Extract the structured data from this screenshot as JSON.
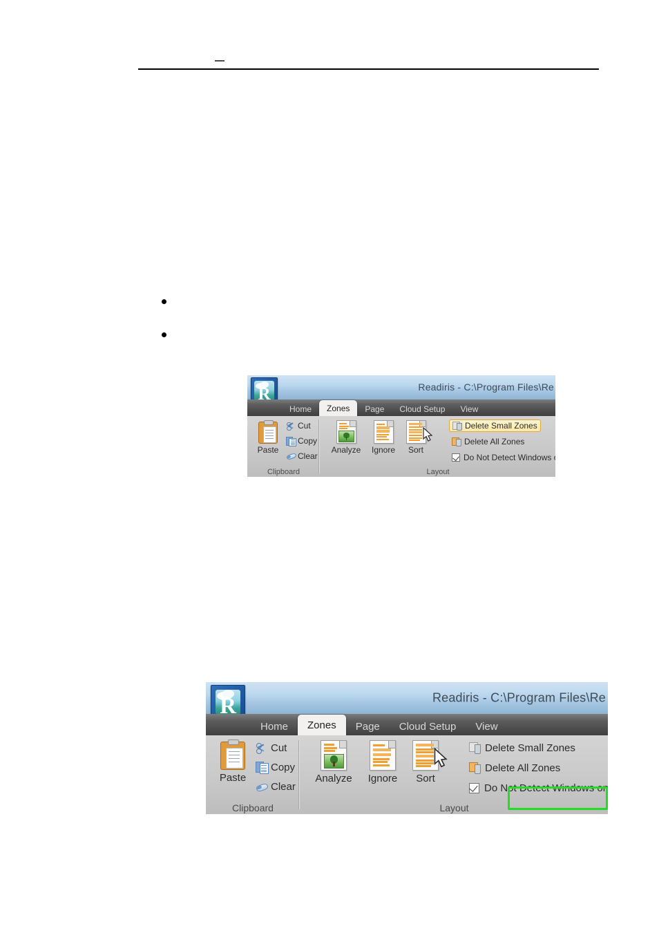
{
  "document": {
    "header_dash": "—",
    "bullets": [
      {
        "text": ""
      },
      {
        "text": ""
      }
    ]
  },
  "app": {
    "title": "Readiris - C:\\Program Files\\Re",
    "logo_letter": "R",
    "logo_name": "readiris-app-icon",
    "tabs": [
      {
        "label": "Home",
        "active": false
      },
      {
        "label": "Zones",
        "active": true
      },
      {
        "label": "Page",
        "active": false
      },
      {
        "label": "Cloud Setup",
        "active": false
      },
      {
        "label": "View",
        "active": false
      }
    ],
    "groups": {
      "clipboard": {
        "label": "Clipboard",
        "paste_label": "Paste",
        "items": [
          {
            "label": "Cut",
            "icon": "scissors-icon"
          },
          {
            "label": "Copy",
            "icon": "copy-icon"
          },
          {
            "label": "Clear",
            "icon": "eraser-icon"
          }
        ]
      },
      "layout": {
        "label": "Layout",
        "buttons": [
          {
            "label": "Analyze",
            "icon": "analyze-document-icon"
          },
          {
            "label": "Ignore",
            "icon": "ignore-document-icon"
          },
          {
            "label": "Sort",
            "icon": "sort-document-icon"
          }
        ],
        "list": [
          {
            "label": "Delete Small Zones",
            "icon": "delete-small-zones-icon",
            "type": "command"
          },
          {
            "label": "Delete All Zones",
            "icon": "delete-all-zones-icon",
            "type": "command"
          },
          {
            "label": "Do Not Detect Windows on Borders",
            "icon": "checkbox",
            "type": "checkbox",
            "checked": true
          }
        ]
      }
    }
  },
  "figures": {
    "figure_1": {
      "name": "readiris-ribbon-delete-small-zones-hovered",
      "hovered_item": "Delete Small Zones",
      "highlight": "hover"
    },
    "figure_2": {
      "name": "readiris-ribbon-do-not-detect-windows-highlighted",
      "highlighted_item": "Do Not Detect Windows on Borders",
      "highlight_color": "#22dd22"
    }
  }
}
